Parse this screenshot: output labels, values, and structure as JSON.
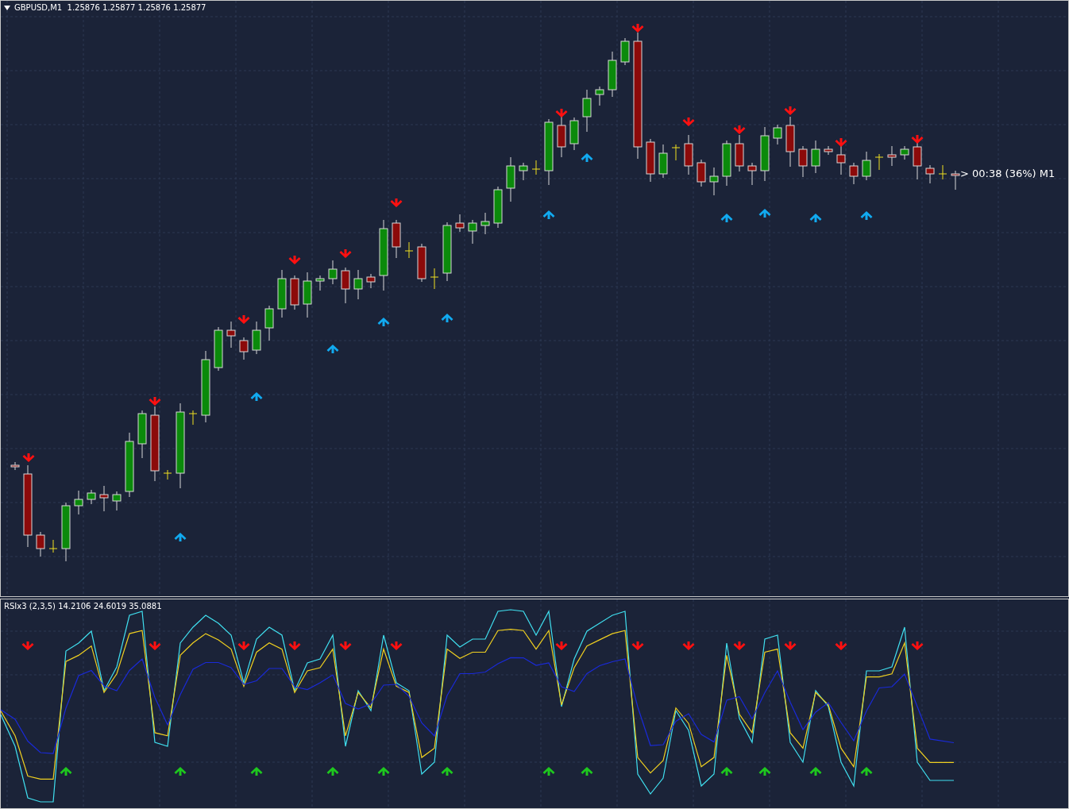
{
  "main_chart": {
    "header": "GBPUSD,M1  1.25876 1.25877 1.25876 1.25877",
    "timer": "> 00:38 (36%) M1"
  },
  "indicator_panel": {
    "header": "RSIx3 (2,3,5) 14.2106 24.6019 35.0881"
  }
}
